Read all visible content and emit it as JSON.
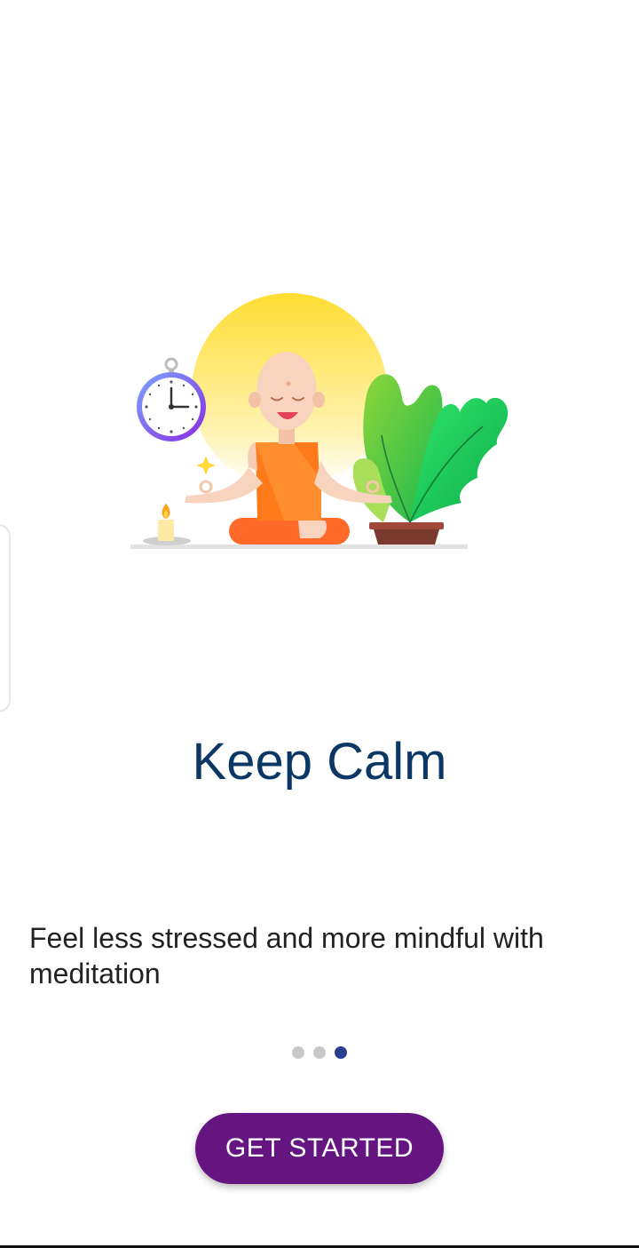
{
  "onboarding": {
    "title": "Keep Calm",
    "description": "Feel less stressed and more mindful with meditation",
    "page_indicator": {
      "total": 3,
      "current": 3
    },
    "cta_label": "GET STARTED"
  },
  "illustration": {
    "icons": [
      "meditating-monk-icon",
      "stopwatch-icon",
      "candle-icon",
      "potted-plant-icon",
      "sparkle-icon"
    ]
  },
  "colors": {
    "title": "#0b3765",
    "cta_background": "#65157f",
    "dot_active": "#2b3e8f",
    "dot_inactive": "#c8c8c8",
    "sun": "#ffdf3d",
    "robe": "#ff7a1a",
    "leaf": "#2fcc55"
  }
}
